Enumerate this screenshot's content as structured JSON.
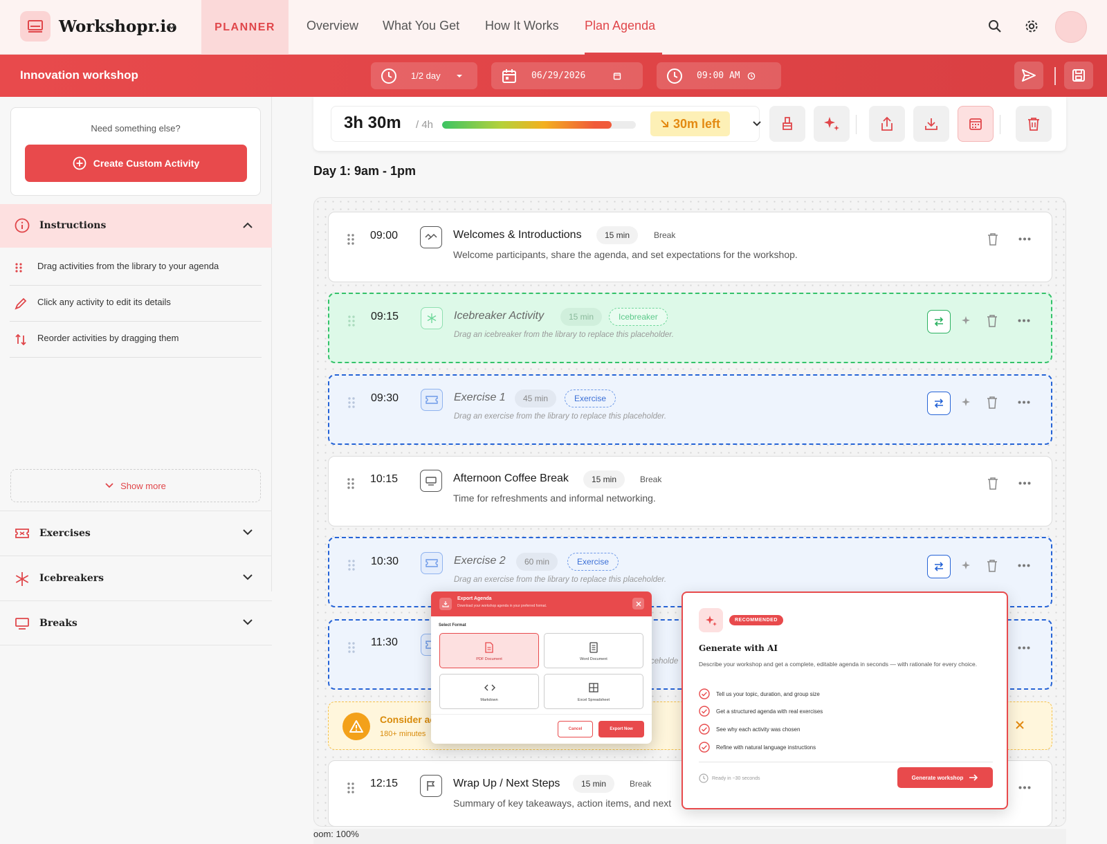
{
  "app": {
    "brand": "Workshopr.io",
    "tab_planner": "PLANNER",
    "nav": [
      "Overview",
      "What You Get",
      "How It Works",
      "Plan Agenda"
    ],
    "active_nav": "Plan Agenda"
  },
  "toolbar": {
    "workshop_title": "Innovation workshop",
    "length": "1/2 day",
    "date": "06/29/2026",
    "start_time": "09:00 AM"
  },
  "sidebar": {
    "need_text": "Need something else?",
    "create_label": "Create Custom Activity",
    "instructions_label": "Instructions",
    "instructions": [
      "Drag activities from the library to your agenda",
      "Click any activity to edit its details",
      "Reorder activities by dragging them"
    ],
    "show_more": "Show more",
    "sections": [
      "Exercises",
      "Icebreakers",
      "Breaks"
    ]
  },
  "stats": {
    "duration": "3h 30m",
    "total": "/ 4h",
    "progress_fraction": 0.875,
    "left": "30m left"
  },
  "agenda": {
    "day_heading": "Day 1: 9am - 1pm",
    "items": [
      {
        "time": "09:00",
        "title": "Welcomes & Introductions",
        "minutes": "15 min",
        "tag": "Break",
        "desc": "Welcome participants, share the agenda, and set expectations for the workshop."
      },
      {
        "time": "09:15",
        "title": "Icebreaker Activity",
        "minutes": "15 min",
        "tag": "Icebreaker",
        "desc": "Drag an icebreaker from the library to replace this placeholder."
      },
      {
        "time": "09:30",
        "title": "Exercise 1",
        "minutes": "45 min",
        "tag": "Exercise",
        "desc": "Drag an exercise from the library to replace this placeholder."
      },
      {
        "time": "10:15",
        "title": "Afternoon Coffee Break",
        "minutes": "15 min",
        "tag": "Break",
        "desc": "Time for refreshments and informal networking."
      },
      {
        "time": "10:30",
        "title": "Exercise 2",
        "minutes": "60 min",
        "tag": "Exercise",
        "desc": "Drag an exercise from the library to replace this placeholder."
      },
      {
        "time": "11:30",
        "desc_partial": "ceholde"
      },
      {
        "time": "12:15",
        "title": "Wrap Up / Next Steps",
        "minutes": "15 min",
        "tag": "Break",
        "desc": "Summary of key takeaways, action items, and next"
      }
    ],
    "warning_title": "Consider ac",
    "warning_sub": "180+ minutes",
    "zoom_label": "oom: 100%"
  },
  "export_modal": {
    "title": "Export Agenda",
    "subtitle": "Download your workshop agenda in your preferred format.",
    "select_label": "Select Format",
    "formats": [
      "PDF Document",
      "Word Document",
      "Markdown",
      "Excel Spreadsheet"
    ],
    "selected": "PDF Document",
    "cancel": "Cancel",
    "export": "Export Now"
  },
  "ai_panel": {
    "badge": "RECOMMENDED",
    "title": "Generate with AI",
    "desc": "Describe your workshop and get a complete, editable agenda in seconds — with rationale for every choice.",
    "bullets": [
      "Tell us your topic, duration, and group size",
      "Get a structured agenda with real exercises",
      "See why each activity was chosen",
      "Refine with natural language instructions"
    ],
    "ready": "Ready in ~30 seconds",
    "button": "Generate workshop"
  },
  "colors": {
    "accent": "#e84a4c",
    "icebreaker": "#34c26a",
    "exercise": "#2563d6",
    "warning": "#f3a11a"
  }
}
